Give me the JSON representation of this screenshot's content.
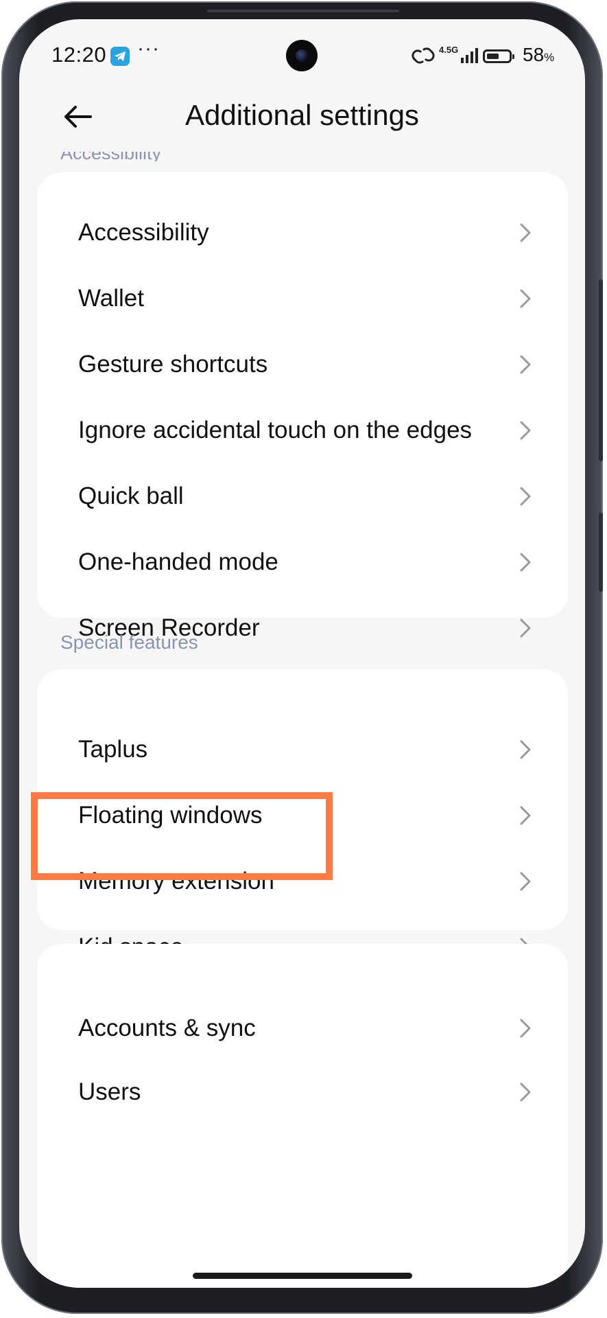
{
  "status_bar": {
    "time": "12:20",
    "more": "···",
    "network": "4.5G",
    "battery_level": 0.58,
    "battery_text": "58",
    "battery_unit": "%"
  },
  "header": {
    "title": "Additional settings",
    "partial_heading": "Accessibility"
  },
  "groups": [
    {
      "items": [
        "Accessibility",
        "Wallet",
        "Gesture shortcuts",
        "Ignore accidental touch on the edges",
        "Quick ball",
        "One-handed mode",
        "Screen Recorder"
      ]
    },
    {
      "heading": "Special features",
      "items": [
        "Taplus",
        "Floating windows",
        "Memory extension",
        "Kid space"
      ]
    },
    {
      "items": [
        "Accounts & sync",
        "Users"
      ]
    }
  ],
  "colors": {
    "highlight": "#ff7a45",
    "section_label": "#8a94b0",
    "background": "#f6f6f6",
    "card": "#ffffff"
  }
}
